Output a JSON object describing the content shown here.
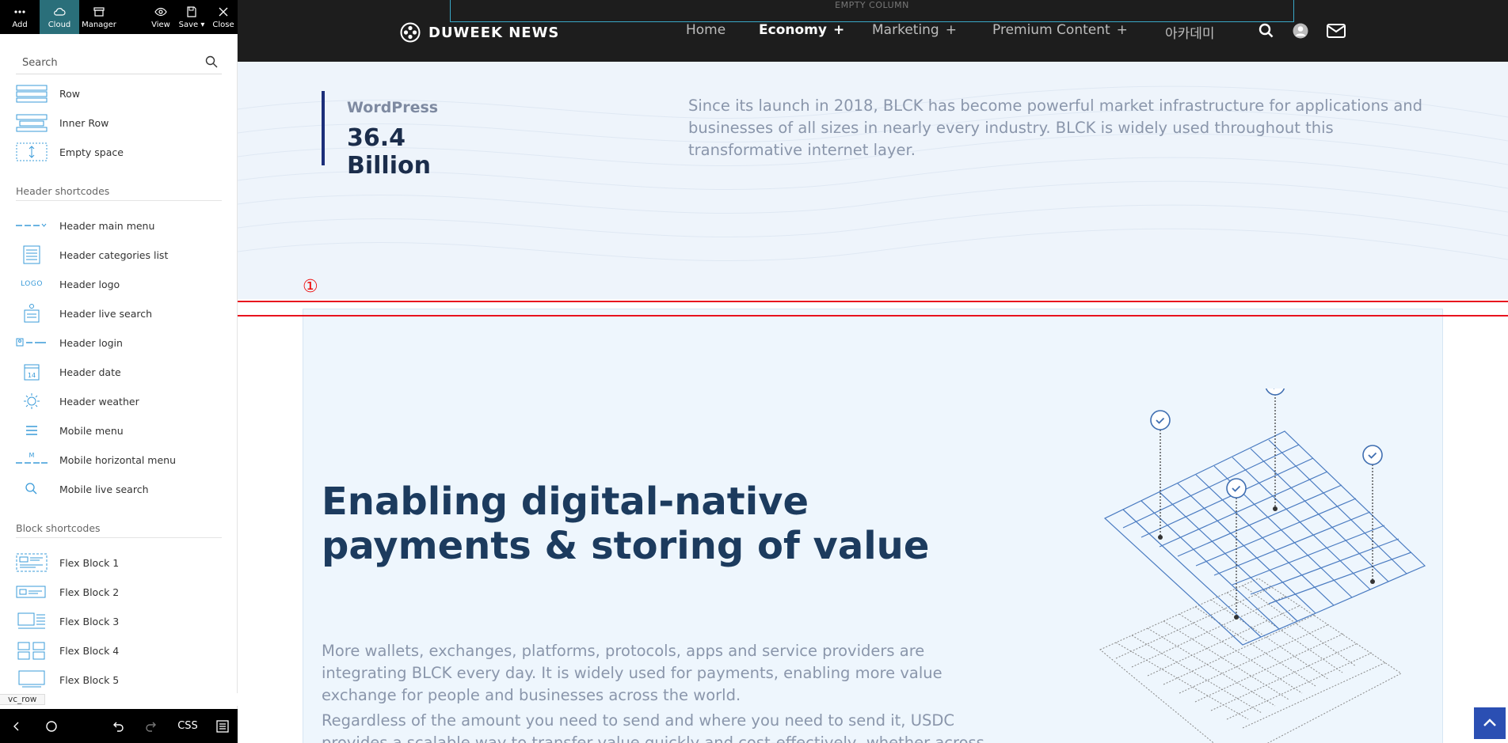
{
  "toolbar": {
    "add": "Add",
    "cloud": "Cloud",
    "manager": "Manager",
    "view": "View",
    "save": "Save",
    "close": "Close"
  },
  "search": {
    "placeholder": "Search"
  },
  "elements": [
    {
      "label": "Row",
      "icon": "row-icon"
    },
    {
      "label": "Inner Row",
      "icon": "inner-row-icon"
    },
    {
      "label": "Empty space",
      "icon": "empty-space-icon"
    }
  ],
  "header_section": "Header shortcodes",
  "header_items": [
    {
      "label": "Header main menu",
      "icon": "main-menu-icon"
    },
    {
      "label": "Header categories list",
      "icon": "categories-list-icon"
    },
    {
      "label": "Header logo",
      "icon": "logo-icon",
      "glyph": "LOGO"
    },
    {
      "label": "Header live search",
      "icon": "live-search-icon"
    },
    {
      "label": "Header login",
      "icon": "login-icon"
    },
    {
      "label": "Header date",
      "icon": "calendar-icon",
      "glyph": "14"
    },
    {
      "label": "Header weather",
      "icon": "sun-icon"
    },
    {
      "label": "Mobile menu",
      "icon": "hamburger-icon"
    },
    {
      "label": "Mobile horizontal menu",
      "icon": "horizontal-menu-icon",
      "glyph": "M"
    },
    {
      "label": "Mobile live search",
      "icon": "search-icon"
    }
  ],
  "block_section": "Block shortcodes",
  "block_items": [
    {
      "label": "Flex Block 1",
      "icon": "flex-block-icon"
    },
    {
      "label": "Flex Block 2",
      "icon": "flex-block-icon"
    },
    {
      "label": "Flex Block 3",
      "icon": "flex-block-icon"
    },
    {
      "label": "Flex Block 4",
      "icon": "flex-block-icon"
    },
    {
      "label": "Flex Block 5",
      "icon": "flex-block-icon"
    }
  ],
  "breadcrumb_tag": "vc_row",
  "bottombar": {
    "css_label": "CSS"
  },
  "site": {
    "empty_column": "EMPTY COLUMN",
    "brand": "DUWEEK NEWS",
    "nav": [
      {
        "label": "Home",
        "plus": ""
      },
      {
        "label": "Economy",
        "plus": "+"
      },
      {
        "label": "Marketing",
        "plus": "+"
      },
      {
        "label": "Premium Content",
        "plus": "+"
      },
      {
        "label": "아카데미",
        "plus": ""
      }
    ]
  },
  "hero": {
    "stat_label": "WordPress",
    "stat_value": "36.4 Billion",
    "description": "Since its launch in 2018, BLCK has become powerful market infrastructure for applications and businesses of all sizes in nearly every industry. BLCK is widely used throughout this transformative internet layer."
  },
  "marker": "①",
  "feature": {
    "title": "Enabling digital-native payments & storing of value",
    "para1": "More wallets, exchanges, platforms, protocols, apps and service providers are integrating BLCK every day. It is widely used for payments, enabling more value exchange for people and businesses across the world.",
    "para2": "Regardless of the amount you need to send and where you need to send it, USDC provides a scalable way to transfer value quickly and cost-effectively, whether across the street or across borders. USDC is available to everyone with an internet connection."
  },
  "colors": {
    "toolbar_bg": "#000000",
    "cloud_active": "#2a6f7a",
    "header_bg": "#1d1d1d",
    "accent_blue": "#2b4fb3",
    "highlight_red": "#e8131e",
    "title_navy": "#1c3b5e"
  }
}
